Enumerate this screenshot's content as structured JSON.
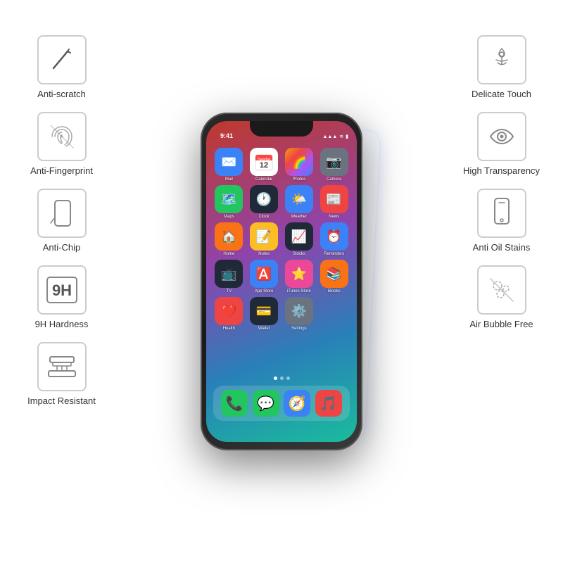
{
  "left_features": [
    {
      "id": "anti-scratch",
      "label": "Anti-scratch",
      "icon_type": "scratch"
    },
    {
      "id": "anti-fingerprint",
      "label": "Anti-Fingerprint",
      "icon_type": "fingerprint"
    },
    {
      "id": "anti-chip",
      "label": "Anti-Chip",
      "icon_type": "chip"
    },
    {
      "id": "9h-hardness",
      "label": "9H Hardness",
      "icon_type": "9h"
    },
    {
      "id": "impact-resistant",
      "label": "Impact Resistant",
      "icon_type": "impact"
    }
  ],
  "right_features": [
    {
      "id": "delicate-touch",
      "label": "Delicate Touch",
      "icon_type": "touch"
    },
    {
      "id": "high-transparency",
      "label": "High Transparency",
      "icon_type": "eye"
    },
    {
      "id": "anti-oil-stains",
      "label": "Anti Oil Stains",
      "icon_type": "phone-outline"
    },
    {
      "id": "air-bubble-free",
      "label": "Air Bubble Free",
      "icon_type": "bubble"
    }
  ],
  "phone": {
    "status_time": "9:41",
    "apps": [
      {
        "name": "Mail",
        "color": "#3b82f6",
        "emoji": "✉️"
      },
      {
        "name": "Calendar",
        "color": "#fff",
        "emoji": "📅"
      },
      {
        "name": "Photos",
        "color": "#f59e0b",
        "emoji": "🌈"
      },
      {
        "name": "Camera",
        "color": "#6b7280",
        "emoji": "📷"
      },
      {
        "name": "Maps",
        "color": "#22c55e",
        "emoji": "🗺️"
      },
      {
        "name": "Clock",
        "color": "#1f2937",
        "emoji": "🕐"
      },
      {
        "name": "Weather",
        "color": "#3b82f6",
        "emoji": "🌤️"
      },
      {
        "name": "News",
        "color": "#ef4444",
        "emoji": "📰"
      },
      {
        "name": "Home",
        "color": "#f97316",
        "emoji": "🏠"
      },
      {
        "name": "Notes",
        "color": "#fbbf24",
        "emoji": "📝"
      },
      {
        "name": "Stocks",
        "color": "#1f2937",
        "emoji": "📈"
      },
      {
        "name": "Reminders",
        "color": "#3b82f6",
        "emoji": "⏰"
      },
      {
        "name": "TV",
        "color": "#1f2937",
        "emoji": "📺"
      },
      {
        "name": "App Store",
        "color": "#3b82f6",
        "emoji": "🅰️"
      },
      {
        "name": "iTunes Store",
        "color": "#ec4899",
        "emoji": "⭐"
      },
      {
        "name": "iBooks",
        "color": "#f97316",
        "emoji": "📚"
      },
      {
        "name": "Health",
        "color": "#ef4444",
        "emoji": "❤️"
      },
      {
        "name": "Wallet",
        "color": "#1f2937",
        "emoji": "💳"
      },
      {
        "name": "Settings",
        "color": "#6b7280",
        "emoji": "⚙️"
      }
    ],
    "dock_apps": [
      {
        "name": "Phone",
        "color": "#22c55e",
        "emoji": "📞"
      },
      {
        "name": "Messages",
        "color": "#22c55e",
        "emoji": "💬"
      },
      {
        "name": "Safari",
        "color": "#3b82f6",
        "emoji": "🧭"
      },
      {
        "name": "Music",
        "color": "#ef4444",
        "emoji": "🎵"
      }
    ]
  }
}
